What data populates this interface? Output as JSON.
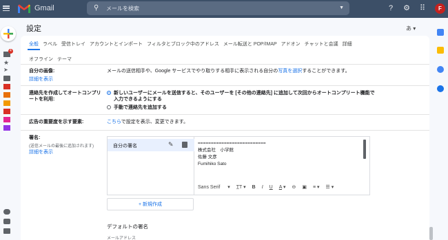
{
  "app": {
    "name": "Gmail"
  },
  "search": {
    "placeholder": "メールを検索"
  },
  "user": {
    "initial": "F"
  },
  "badge": {
    "inbox_count": "4"
  },
  "settings": {
    "title": "設定",
    "lang_indicator": "あ",
    "tabs": [
      "全般",
      "ラベル",
      "受信トレイ",
      "アカウントとインポート",
      "フィルタとブロック中のアドレス",
      "メール転送と POP/IMAP",
      "アドオン",
      "チャットと会議",
      "詳細"
    ],
    "tabs_row2": [
      "オフライン",
      "テーマ"
    ]
  },
  "rows": {
    "my_picture": {
      "label": "自分の画像:",
      "link": "詳細を表示",
      "text_before": "メールの送信相手や、Google サービスでやり取りする相手に表示される自分の",
      "text_link": "写真を選択",
      "text_after": "することができます。"
    },
    "autocomplete": {
      "label": "連絡先を作成してオートコンプリートを利用:",
      "option1": "新しいユーザーにメールを送信すると、そのユーザーを [その他の連絡先] に追加して次回からオートコンプリート機能で入力できるようにする",
      "option2": "手動で連絡先を追加する"
    },
    "importance": {
      "label": "広告の重要度を示す要素:",
      "link": "こちら",
      "text": "で設定を表示、変更できます。"
    },
    "signature": {
      "label": "署名:",
      "sub": "(送信メールの最後に追加されます)",
      "link": "詳細を表示",
      "item_name": "自分の署名",
      "lines": [
        "==========================",
        "株式会社　小学館",
        "佐藤 文彦",
        "Fumihiko Sato"
      ],
      "font": "Sans Serif",
      "new_button": "+ 新規作成",
      "default_title": "デフォルトの署名",
      "mail_address": "メールアドレス"
    }
  },
  "colors": {
    "topbar": "#3c4f67",
    "accent": "#1a73e8",
    "avatar": "#c5221f"
  }
}
